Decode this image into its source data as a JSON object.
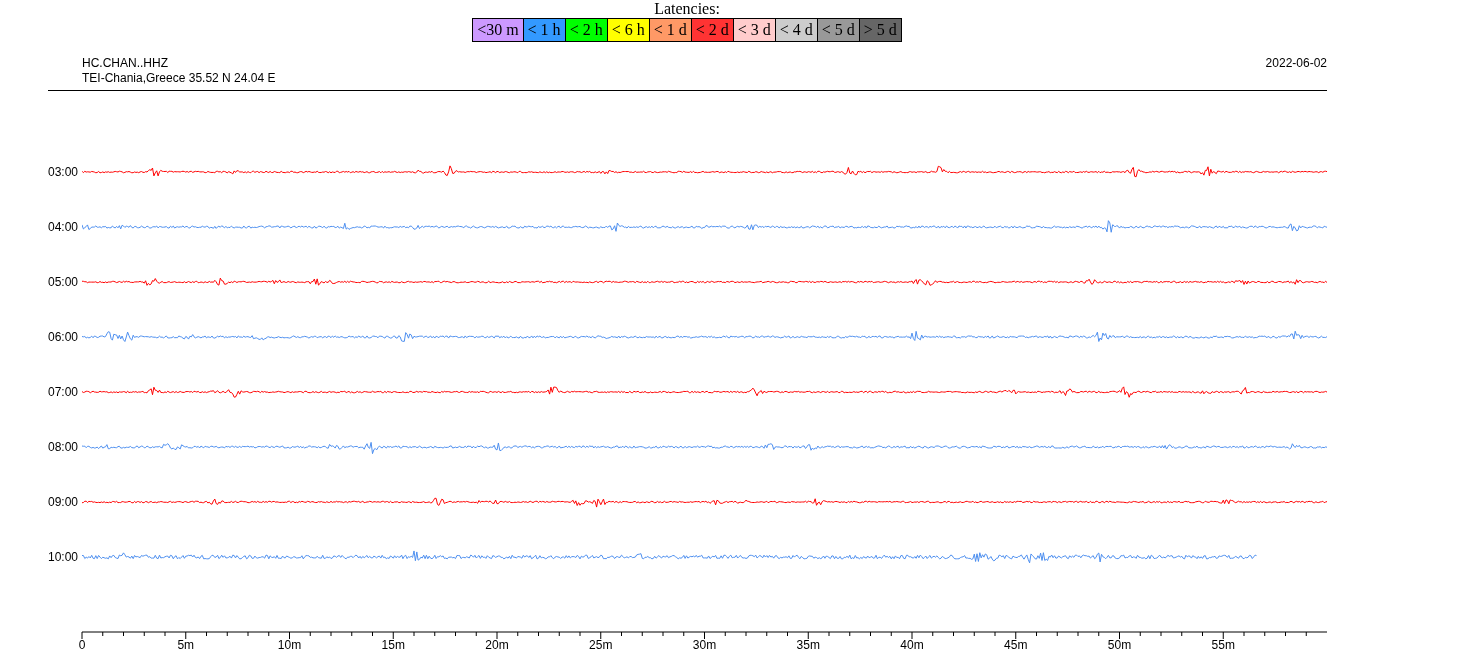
{
  "legend": {
    "title": "Latencies:",
    "items": [
      {
        "label": "<30 m",
        "color": "#cc99ff"
      },
      {
        "label": "< 1 h",
        "color": "#3399ff"
      },
      {
        "label": "< 2 h",
        "color": "#00ff00"
      },
      {
        "label": "< 6 h",
        "color": "#ffff00"
      },
      {
        "label": "< 1 d",
        "color": "#ff9966"
      },
      {
        "label": "< 2 d",
        "color": "#ff3333"
      },
      {
        "label": "< 3 d",
        "color": "#ffcccc"
      },
      {
        "label": "< 4 d",
        "color": "#cccccc"
      },
      {
        "label": "< 5 d",
        "color": "#999999"
      },
      {
        "label": "> 5 d",
        "color": "#666666"
      }
    ]
  },
  "header": {
    "station": "HC.CHAN..HHZ",
    "location": "TEI-Chania,Greece  35.52 N 24.04 E",
    "date": "2022-06-02"
  },
  "traces": [
    {
      "time": "03:00",
      "color": "#ff0000",
      "level": 1
    },
    {
      "time": "04:00",
      "color": "#4d8ff0",
      "level": 1
    },
    {
      "time": "05:00",
      "color": "#ff0000",
      "level": 1
    },
    {
      "time": "06:00",
      "color": "#4d8ff0",
      "level": 1
    },
    {
      "time": "07:00",
      "color": "#ff0000",
      "level": 1
    },
    {
      "time": "08:00",
      "color": "#4d8ff0",
      "level": 1
    },
    {
      "time": "09:00",
      "color": "#ff0000",
      "level": 1
    },
    {
      "time": "10:00",
      "color": "#4d8ff0",
      "level": 0.943
    }
  ],
  "axis": {
    "labels": [
      "0",
      "5m",
      "10m",
      "15m",
      "20m",
      "25m",
      "30m",
      "35m",
      "40m",
      "45m",
      "50m",
      "55m"
    ]
  }
}
